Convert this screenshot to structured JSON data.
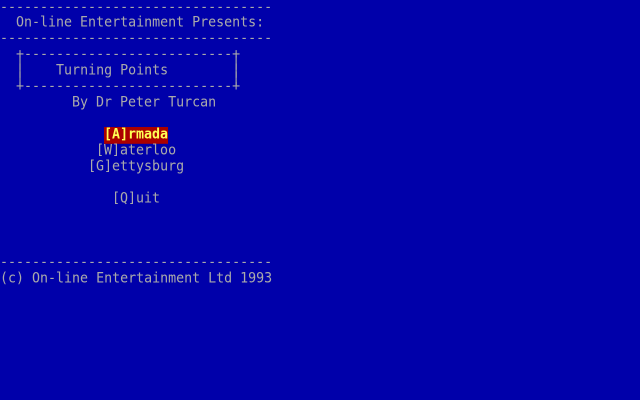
{
  "screen": {
    "rule_top": "----------------------------------",
    "presents": "  On-line Entertainment Presents:",
    "rule_under_presents": "----------------------------------",
    "box_top": "  +--------------------------+",
    "box_empty_left": "  |",
    "box_empty_right": "|",
    "title": "Turning Points",
    "box_bottom": "  +--------------------------+",
    "author": "By Dr Peter Turcan",
    "rule_bottom": "----------------------------------",
    "copyright": "(c) On-line Entertainment Ltd 1993"
  },
  "menu": {
    "items": [
      {
        "key": "[A]",
        "rest": "rmada",
        "selected": true
      },
      {
        "key": "[W]",
        "rest": "aterloo",
        "selected": false
      },
      {
        "key": "[G]",
        "rest": "ettysburg",
        "selected": false
      }
    ],
    "quit": {
      "key": "[Q]",
      "rest": "uit"
    }
  },
  "colors": {
    "background": "#0000aa",
    "text": "#aaaaaa",
    "highlight_bg": "#aa0000",
    "highlight_fg": "#ffff55"
  }
}
